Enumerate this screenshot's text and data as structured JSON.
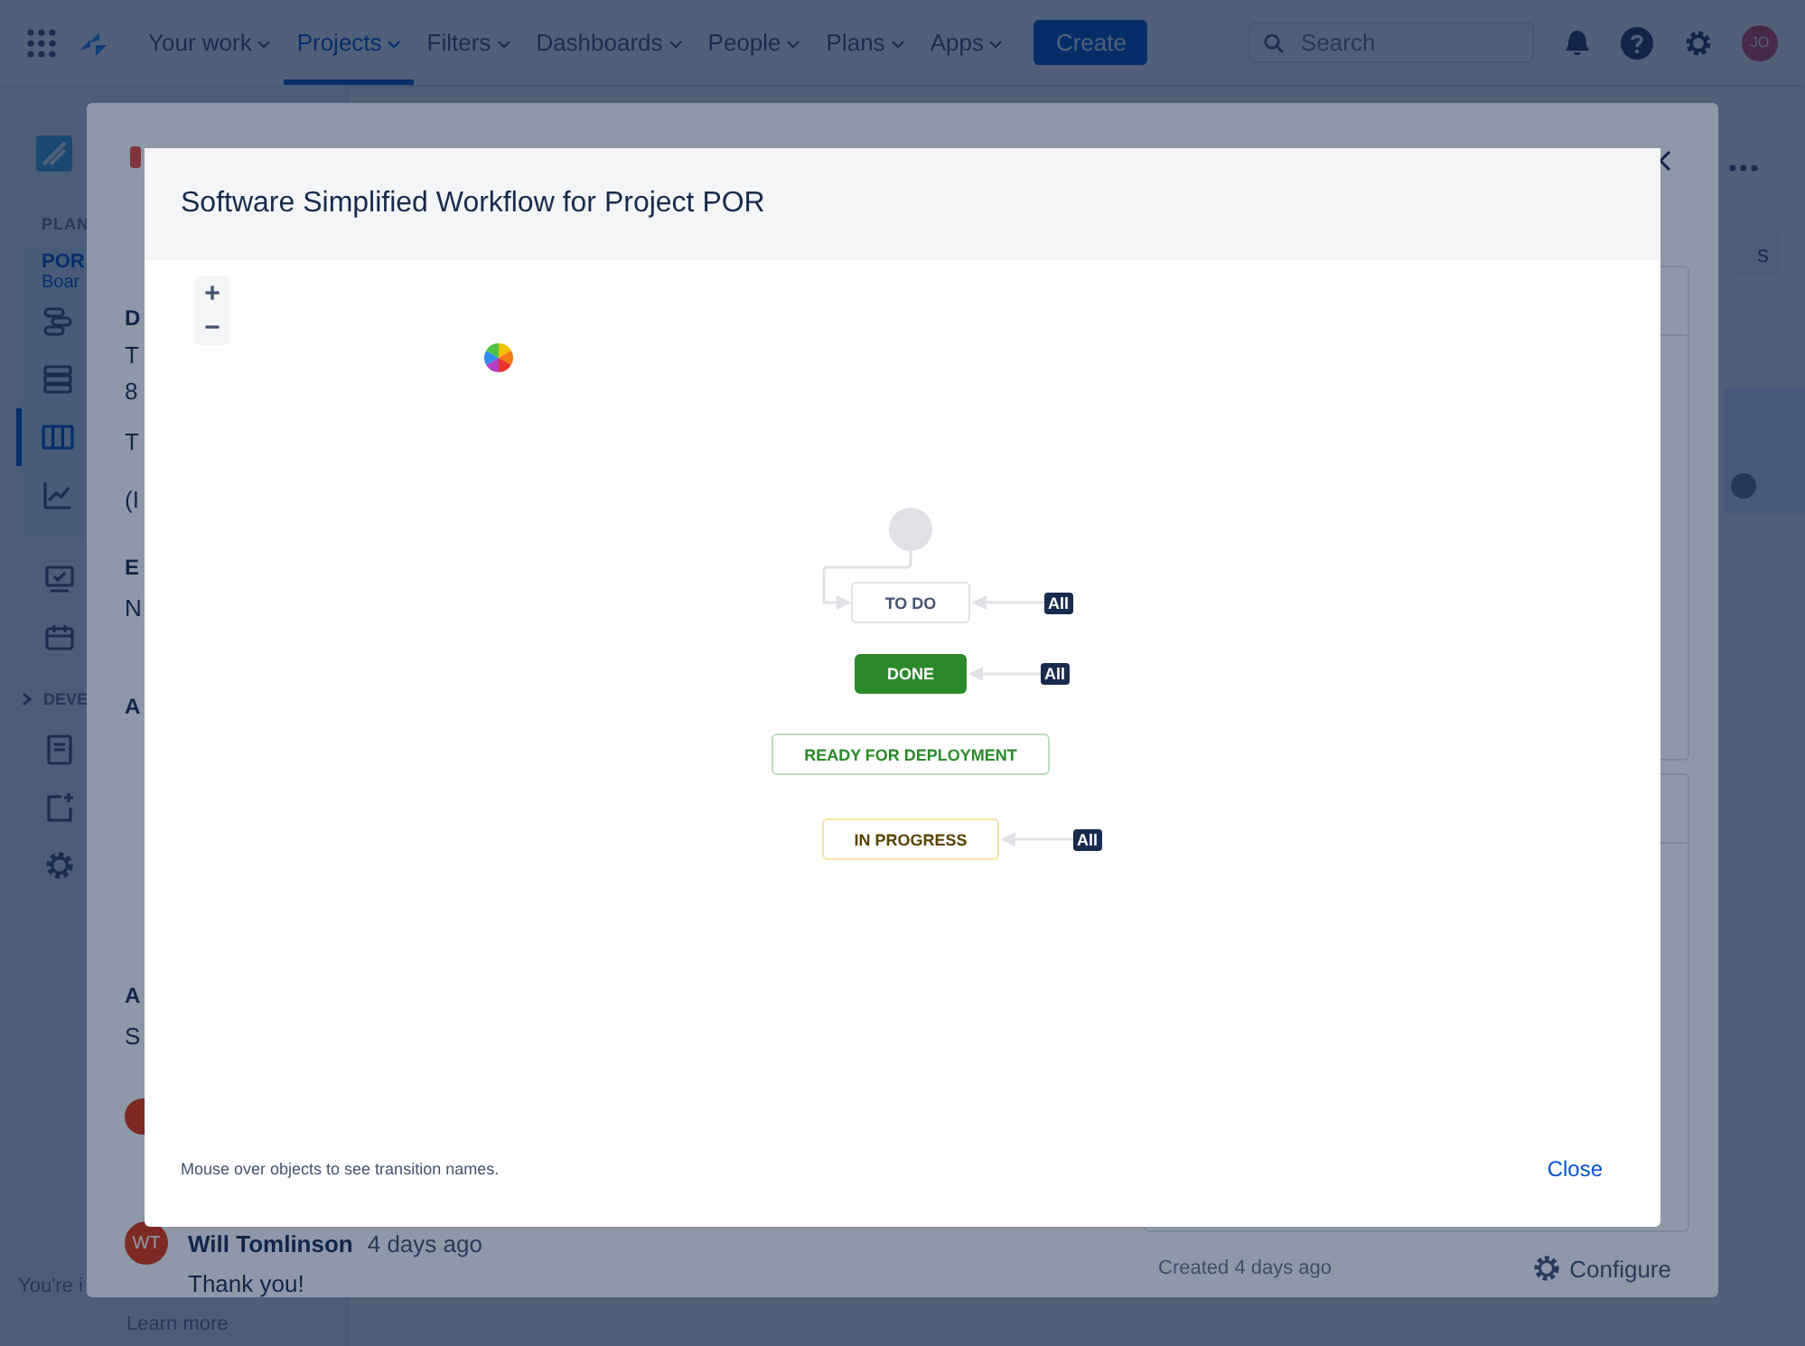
{
  "top_nav": {
    "items": [
      {
        "label": "Your work",
        "selected": false
      },
      {
        "label": "Projects",
        "selected": true
      },
      {
        "label": "Filters",
        "selected": false
      },
      {
        "label": "Dashboards",
        "selected": false
      },
      {
        "label": "People",
        "selected": false
      },
      {
        "label": "Plans",
        "selected": false
      },
      {
        "label": "Apps",
        "selected": false
      }
    ],
    "create_button": "Create",
    "search": {
      "placeholder": "Search"
    },
    "avatar": "JO"
  },
  "sidebar": {
    "section": "PLAN",
    "project": "POR",
    "project_sub": "Boar",
    "nav_icons": [
      {
        "selected": false
      },
      {
        "selected": false
      },
      {
        "selected": true
      },
      {
        "selected": false
      }
    ],
    "dev_section": "DEVE",
    "footer_text": "You're i",
    "footer_link": "Learn more"
  },
  "page_side": {
    "button_text": "s"
  },
  "issue_view": {
    "left_texts": [
      {
        "text": "D",
        "kind": "heading"
      },
      {
        "text": "T",
        "kind": "text"
      },
      {
        "text": "8",
        "kind": "text"
      },
      {
        "text": "T",
        "kind": "text"
      },
      {
        "text": "(I",
        "kind": "text"
      },
      {
        "text": "E",
        "kind": "heading"
      },
      {
        "text": "N",
        "kind": "text"
      },
      {
        "text": "A",
        "kind": "heading"
      },
      {
        "text": "A",
        "kind": "heading"
      },
      {
        "text": "S",
        "kind": "text"
      }
    ],
    "comment": {
      "avatar": "WT",
      "author": "Will Tomlinson",
      "time": "4 days ago",
      "body": "Thank you!"
    },
    "created": "Created 4 days ago",
    "configure": "Configure"
  },
  "workflow_dialog": {
    "title": "Software Simplified Workflow for Project POR",
    "zoom_in": "+",
    "zoom_out": "−",
    "statuses": [
      {
        "label": "TO DO",
        "kind": "todo",
        "global_transition": "All"
      },
      {
        "label": "DONE",
        "kind": "done",
        "global_transition": "All"
      },
      {
        "label": "READY FOR DEPLOYMENT",
        "kind": "success"
      },
      {
        "label": "IN PROGRESS",
        "kind": "progress",
        "global_transition": "All"
      }
    ],
    "hint": "Mouse over objects to see transition names.",
    "close": "Close"
  }
}
